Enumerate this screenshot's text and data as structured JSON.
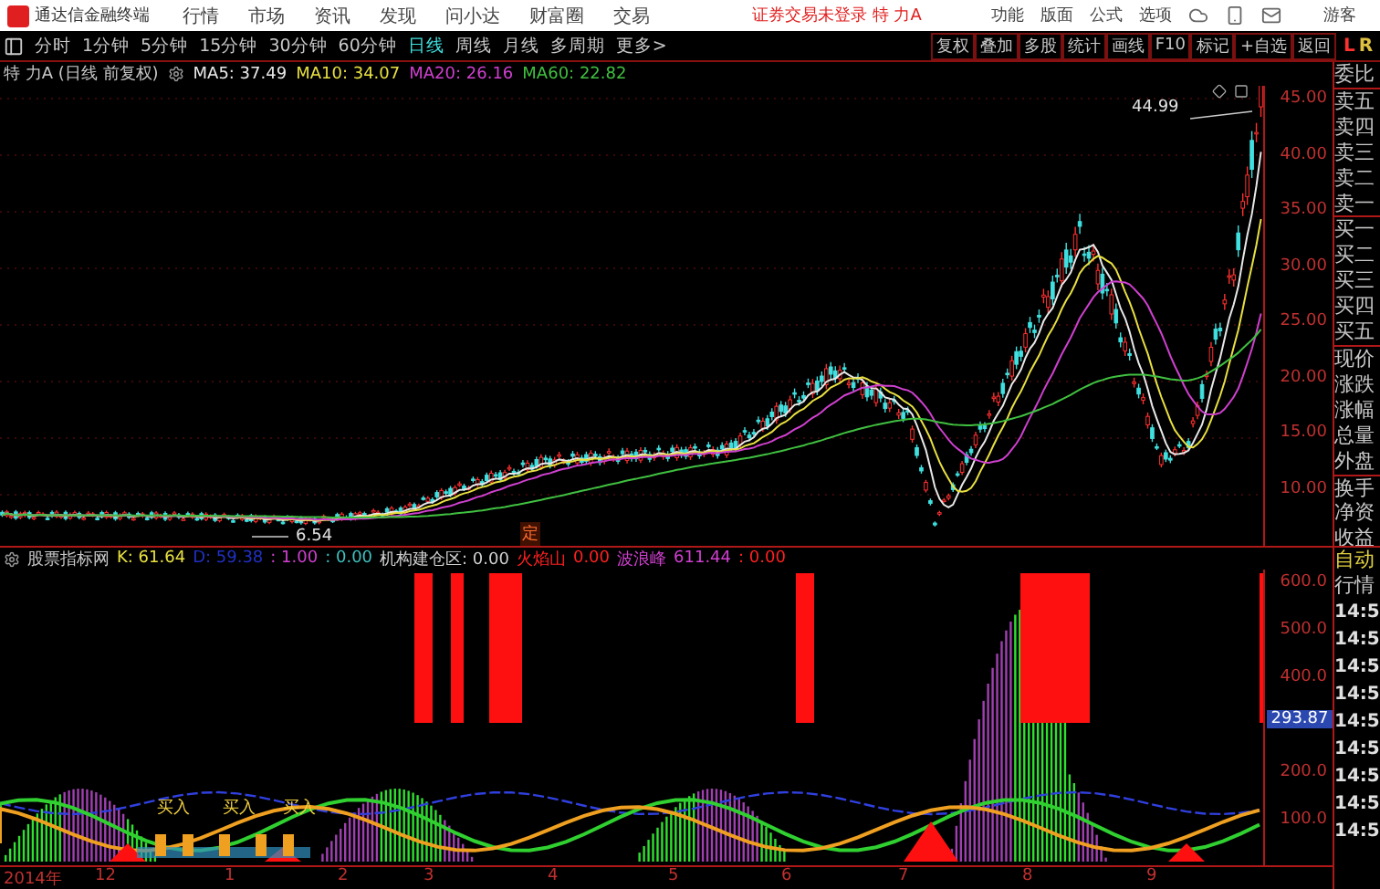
{
  "title_bar": {
    "app_name": "通达信金融终端",
    "menus": [
      "行情",
      "市场",
      "资讯",
      "发现",
      "问小达",
      "财富圈",
      "交易"
    ],
    "login_status": "证券交易未登录 特 力A",
    "right_menus": [
      "功能",
      "版面",
      "公式",
      "选项"
    ],
    "user": "游客"
  },
  "period_tabs": [
    {
      "label": "分时",
      "selected": false
    },
    {
      "label": "1分钟",
      "selected": false
    },
    {
      "label": "5分钟",
      "selected": false
    },
    {
      "label": "15分钟",
      "selected": false
    },
    {
      "label": "30分钟",
      "selected": false
    },
    {
      "label": "60分钟",
      "selected": false
    },
    {
      "label": "日线",
      "selected": true
    },
    {
      "label": "周线",
      "selected": false
    },
    {
      "label": "月线",
      "selected": false
    },
    {
      "label": "多周期",
      "selected": false
    },
    {
      "label": "更多>",
      "selected": false
    }
  ],
  "tools": [
    "复权",
    "叠加",
    "多股",
    "统计",
    "画线",
    "F10",
    "标记",
    "+自选",
    "返回"
  ],
  "level_badge": [
    "L",
    "R"
  ],
  "chart": {
    "title": "特 力A (日线 前复权)",
    "ma": [
      {
        "label": "MA5: 37.49",
        "color": "#e8e8e8"
      },
      {
        "label": "MA10: 34.07",
        "color": "#e8e040"
      },
      {
        "label": "MA20: 26.16",
        "color": "#d040d0"
      },
      {
        "label": "MA60: 22.82",
        "color": "#40c040"
      }
    ],
    "high_label": "44.99",
    "low_label": "6.54",
    "marker": "定",
    "price_ticks": [
      "45.00",
      "40.00",
      "35.00",
      "30.00",
      "25.00",
      "20.00",
      "15.00",
      "10.00"
    ]
  },
  "indicator": {
    "name": "股票指标网",
    "values": [
      {
        "text": "K: 61.64",
        "color": "#e8e040"
      },
      {
        "text": "D: 59.38",
        "color": "#2030c0"
      },
      {
        "text": ": 1.00",
        "color": "#d040d0"
      },
      {
        "text": ": 0.00",
        "color": "#40c0c0"
      },
      {
        "text": "机构建仓区: 0.00",
        "color": "#d0d0d0"
      },
      {
        "text": "火焰山",
        "color": "#ff2020"
      },
      {
        "text": "0.00",
        "color": "#ff2020"
      },
      {
        "text": "波浪峰",
        "color": "#d040d0"
      },
      {
        "text": "611.44",
        "color": "#d040d0"
      },
      {
        "text": ": 0.00",
        "color": "#ff2020"
      }
    ],
    "buy_labels": [
      "买入",
      "买入",
      "买入"
    ],
    "ticks": [
      "600.0",
      "500.0",
      "400.0",
      "200.0",
      "100.0"
    ],
    "current_value": "293.87"
  },
  "date_axis": [
    "2014年",
    "12",
    "1",
    "2",
    "3",
    "4",
    "5",
    "6",
    "7",
    "8",
    "9"
  ],
  "quote_panel": [
    "委比",
    "卖五",
    "卖四",
    "卖三",
    "卖二",
    "卖一",
    "买一",
    "买二",
    "买三",
    "买四",
    "买五",
    "现价",
    "涨跌",
    "涨幅",
    "总量",
    "外盘",
    "换手",
    "净资",
    "收益"
  ],
  "time_panel": {
    "mode": "自动",
    "title": "行情",
    "times": [
      "14:5",
      "14:5",
      "14:5",
      "14:5",
      "14:5",
      "14:5",
      "14:5",
      "14:5",
      "14:5"
    ]
  }
}
